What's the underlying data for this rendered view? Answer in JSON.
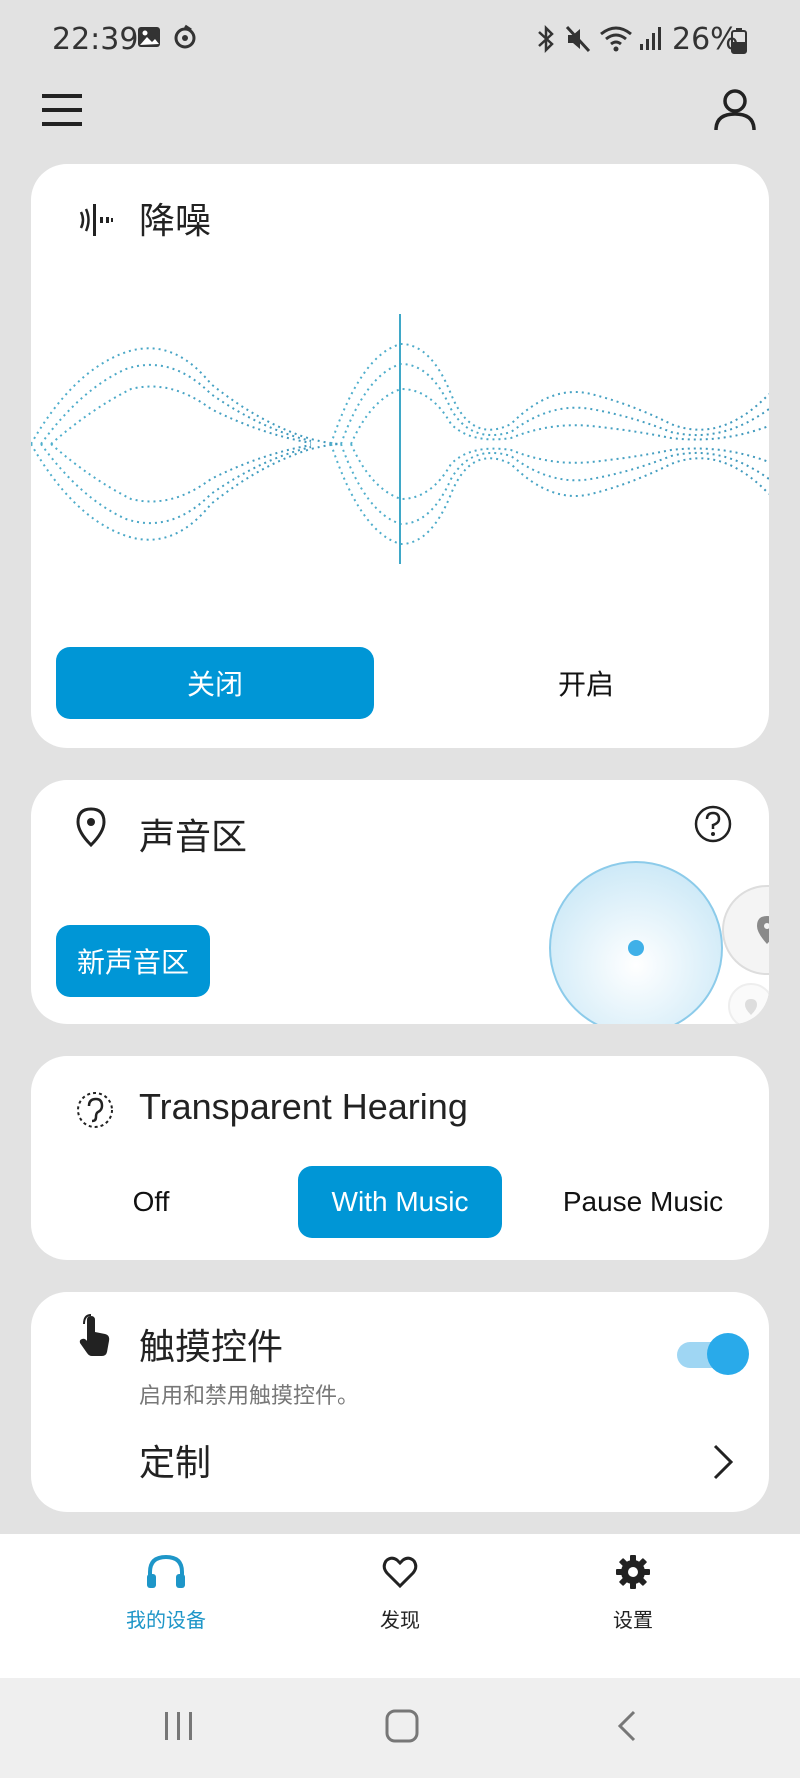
{
  "status_bar": {
    "time": "22:39",
    "battery_text": "26%"
  },
  "noise_cancel": {
    "title": "降噪",
    "off_label": "关闭",
    "on_label": "开启",
    "selected": "off"
  },
  "sound_zone": {
    "title": "声音区",
    "new_zone_label": "新声音区"
  },
  "transparent_hearing": {
    "title": "Transparent Hearing",
    "options": [
      "Off",
      "With Music",
      "Pause Music"
    ],
    "selected": "With Music"
  },
  "touch_controls": {
    "title": "触摸控件",
    "subtitle": "启用和禁用触摸控件。",
    "customize_label": "定制",
    "enabled": true
  },
  "bottom_nav": {
    "items": [
      {
        "label": "我的设备",
        "icon": "headphones-icon",
        "active": true
      },
      {
        "label": "发现",
        "icon": "heart-icon",
        "active": false
      },
      {
        "label": "设置",
        "icon": "gear-icon",
        "active": false
      }
    ]
  },
  "colors": {
    "accent": "#0096d6",
    "background": "#e2e2e2",
    "card": "#ffffff"
  }
}
